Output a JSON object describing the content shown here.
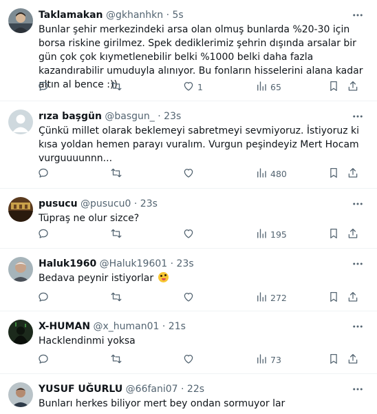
{
  "tweets": [
    {
      "name": "Taklamakan",
      "handle": "@gkhanhkn",
      "separator": "·",
      "time": "5s",
      "text": "Bunlar şehir merkezindeki arsa olan olmuş bunlarda %20-30 için borsa riskine girilmez. Spek dediklerimiz şehrin dışında arsalar bir gün çok çok kıymetlenebilir belki %1000 belki daha fazla kazandırabilir umuduyla alınıyor. Bu fonların hisselerini alana kadar altın al bence :))",
      "replies": "",
      "retweets": "",
      "likes": "1",
      "views": "65"
    },
    {
      "name": "rıza başgün",
      "handle": "@basgun_",
      "separator": "·",
      "time": "23s",
      "text": "Çünkü millet olarak beklemeyi sabretmeyi sevmiyoruz. İstiyoruz ki kısa yoldan hemen parayı vuralım. Vurgun peşindeyiz Mert Hocam vurguuuunnn...",
      "replies": "",
      "retweets": "",
      "likes": "",
      "views": "480"
    },
    {
      "name": "pusucu",
      "handle": "@pusucu0",
      "separator": "·",
      "time": "23s",
      "text": "Tüpraş ne olur sizce?",
      "replies": "",
      "retweets": "",
      "likes": "",
      "views": "195"
    },
    {
      "name": "Haluk1960",
      "handle": "@Haluk19601",
      "separator": "·",
      "time": "23s",
      "text": "Bedava peynir istiyorlar",
      "emoji": "zany-face",
      "replies": "",
      "retweets": "",
      "likes": "",
      "views": "272"
    },
    {
      "name": "X-HUMAN",
      "handle": "@x_human01",
      "separator": "·",
      "time": "21s",
      "text": "Hacklendinmi yoksa",
      "replies": "",
      "retweets": "",
      "likes": "",
      "views": "73"
    },
    {
      "name": "YUSUF UĞURLU",
      "handle": "@66fani07",
      "separator": "·",
      "time": "22s",
      "text": "Bunları herkes biliyor mert bey ondan sormuyor lar"
    }
  ],
  "icons": {
    "reply": "reply-icon",
    "retweet": "retweet-icon",
    "like": "heart-icon",
    "views": "views-icon",
    "bookmark": "bookmark-icon",
    "share": "share-icon",
    "more": "more-icon"
  },
  "colors": {
    "text": "#0f1419",
    "secondary": "#536471",
    "divider": "#eff3f4"
  }
}
